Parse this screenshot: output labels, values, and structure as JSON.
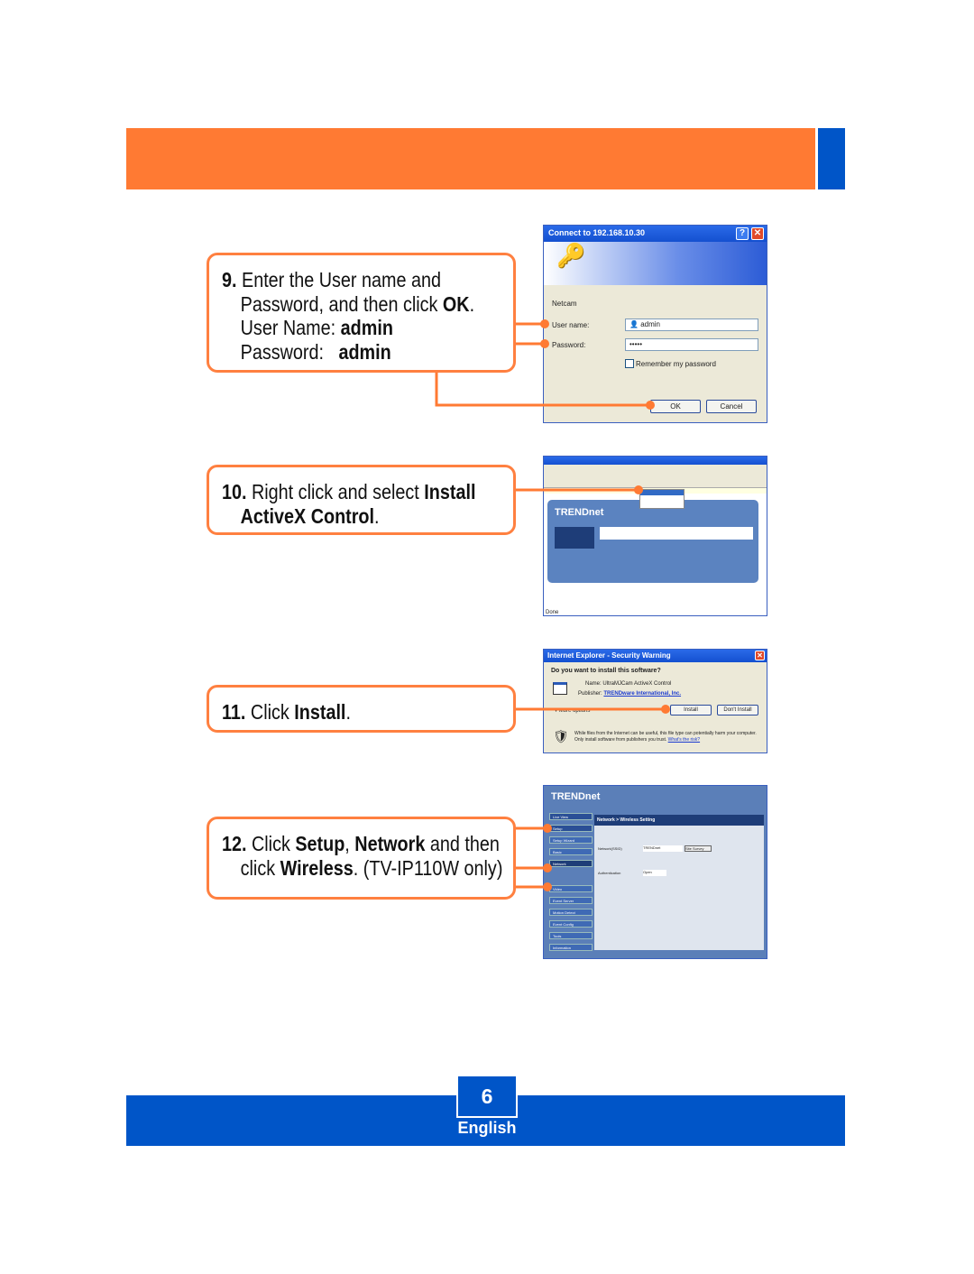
{
  "colors": {
    "accent_orange": "#ff7a33",
    "brand_blue": "#0055c8"
  },
  "steps": [
    {
      "number": "9.",
      "lines": [
        [
          {
            "t": "Enter the User name and",
            "b": false
          }
        ],
        [
          {
            "t": "Password, and then click ",
            "b": false
          },
          {
            "t": "OK",
            "b": true
          },
          {
            "t": ".",
            "b": false
          }
        ],
        [
          {
            "t": "User Name: ",
            "b": false
          },
          {
            "t": "admin",
            "b": true
          }
        ],
        [
          {
            "t": "Password:   ",
            "b": false
          },
          {
            "t": "admin",
            "b": true
          }
        ]
      ]
    },
    {
      "number": "10.",
      "lines": [
        [
          {
            "t": "Right click and select ",
            "b": false
          },
          {
            "t": "Install",
            "b": true
          }
        ],
        [
          {
            "t": "ActiveX Control",
            "b": true
          },
          {
            "t": ".",
            "b": false
          }
        ]
      ]
    },
    {
      "number": "11.",
      "lines": [
        [
          {
            "t": "Click ",
            "b": false
          },
          {
            "t": "Install",
            "b": true
          },
          {
            "t": ".",
            "b": false
          }
        ]
      ]
    },
    {
      "number": "12.",
      "lines": [
        [
          {
            "t": "Click ",
            "b": false
          },
          {
            "t": "Setup",
            "b": true
          },
          {
            "t": ", ",
            "b": false
          },
          {
            "t": "Network",
            "b": true
          },
          {
            "t": " and then",
            "b": false
          }
        ],
        [
          {
            "t": "click ",
            "b": false
          },
          {
            "t": "Wireless",
            "b": true
          },
          {
            "t": ". (TV-IP110W only)",
            "b": false
          }
        ]
      ]
    }
  ],
  "login_dialog": {
    "title": "Connect to 192.168.10.30",
    "realm": "Netcam",
    "user_label": "User name:",
    "user_value": "admin",
    "password_label": "Password:",
    "password_value": "•••••",
    "remember": "Remember my password",
    "ok": "OK",
    "cancel": "Cancel"
  },
  "browser": {
    "logo": "TRENDnet",
    "status": "Done"
  },
  "security_warning": {
    "title": "Internet Explorer - Security Warning",
    "question": "Do you want to install this software?",
    "name_label": "Name:",
    "name_value": "UltraMJCam ActiveX Control",
    "publisher_label": "Publisher:",
    "publisher_value": "TRENDware International, Inc.",
    "more_options": "More options",
    "install": "Install",
    "dont_install": "Don't Install",
    "warning": "While files from the Internet can be useful, this file type can potentially harm your computer. Only install software from publishers you trust.",
    "whats_risk": "What's the risk?"
  },
  "setup_page": {
    "logo": "TRENDnet",
    "heading": "Network > Wireless Setting",
    "nav": [
      "Live View",
      "Setup",
      "Setup Wizard",
      "Basic",
      "Network",
      "Video",
      "Event Server",
      "Motion Detect",
      "Event Config",
      "Tools",
      "Information"
    ],
    "subnav": [
      "Network",
      "Wireless"
    ],
    "ssid_label": "Network(SSID)",
    "ssid_value": "TRENDnet",
    "site_survey": "Site Survey",
    "auth_label": "Authentication",
    "auth_value": "Open"
  },
  "footer": {
    "page_number": "6",
    "language": "English"
  }
}
